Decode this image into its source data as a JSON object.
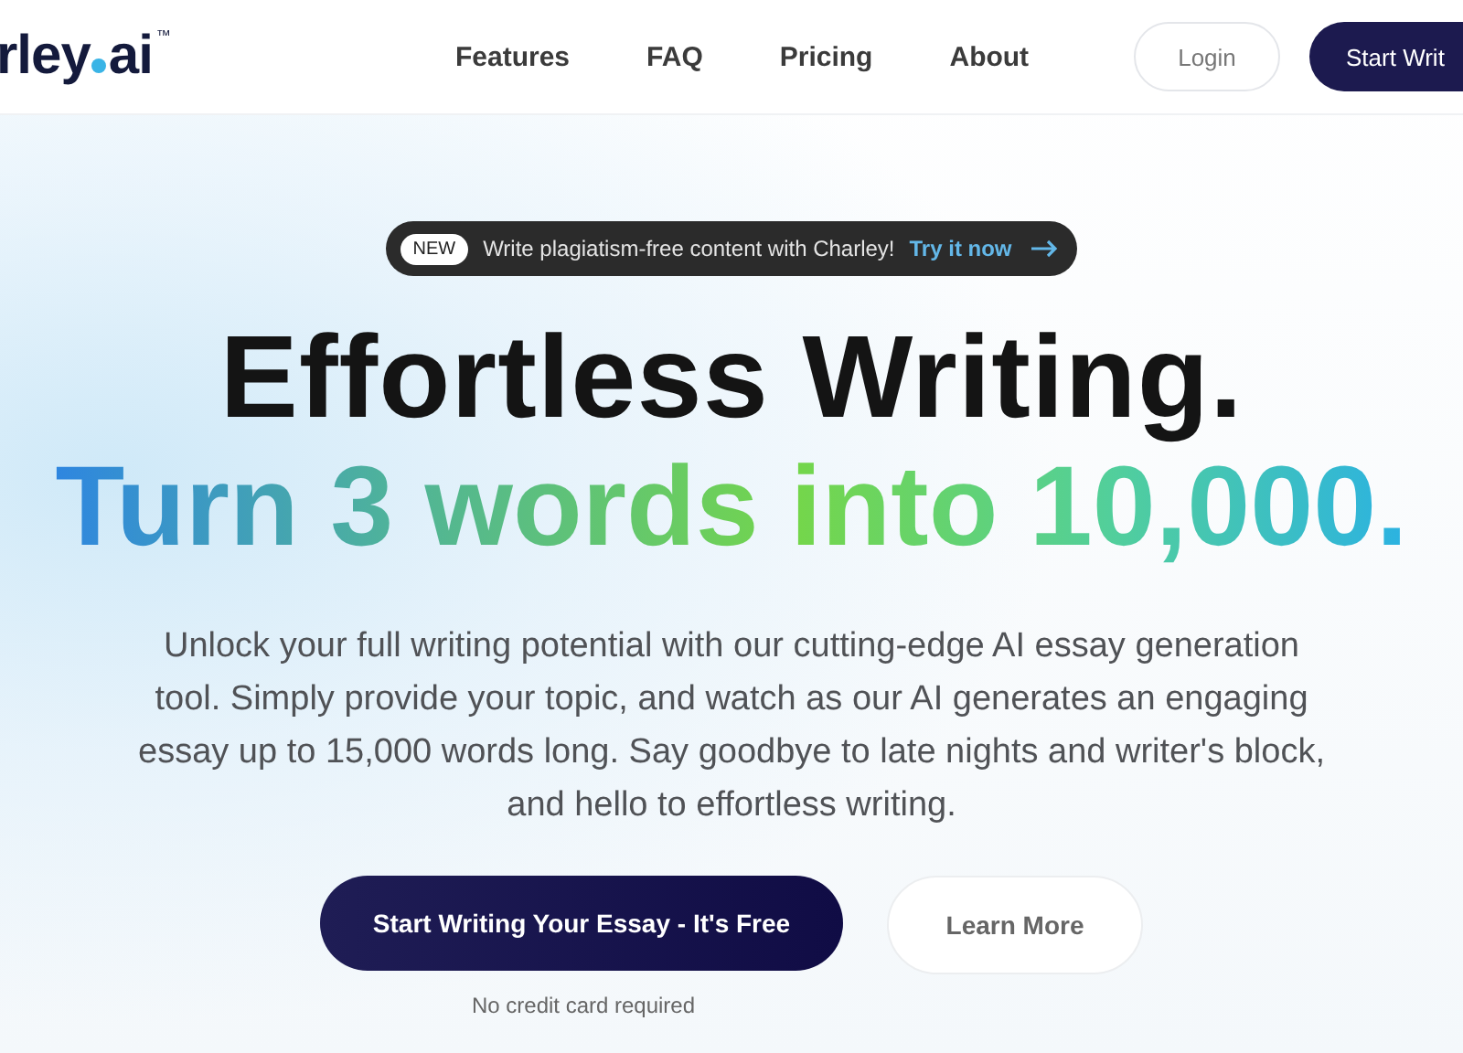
{
  "header": {
    "logo": {
      "name": "rley",
      "suffix": "ai",
      "trademark": "™"
    },
    "nav": [
      {
        "label": "Features"
      },
      {
        "label": "FAQ"
      },
      {
        "label": "Pricing"
      },
      {
        "label": "About"
      }
    ],
    "login": "Login",
    "cta": "Start Writ"
  },
  "announcement": {
    "badge": "NEW",
    "text": "Write plagiatism-free content with Charley!",
    "link": "Try it now"
  },
  "headline": "Effortless Writing.",
  "subheadline": "Turn 3 words into 10,000.",
  "description": "Unlock your full writing potential with our cutting-edge AI essay generation tool. Simply provide your topic, and watch as our AI generates an engaging essay up to 15,000 words long. Say goodbye to late nights and writer's block, and hello to effortless writing.",
  "primary_button": "Start Writing Your Essay - It's Free",
  "secondary_button": "Learn More",
  "note": "No credit card required"
}
